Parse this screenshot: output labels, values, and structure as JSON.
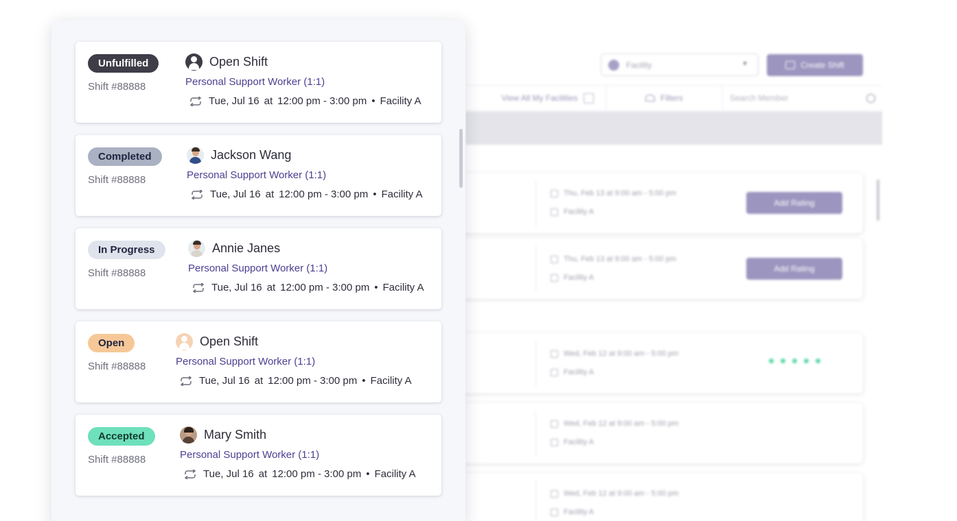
{
  "background": {
    "facility_select": {
      "placeholder": "Facility"
    },
    "create_button": {
      "label": "Create Shift"
    },
    "toolbar": {
      "view_all_label": "View All My Facilities",
      "filters_label": "Filters",
      "search_placeholder": "Search Member"
    },
    "rows": [
      {
        "date": "Thu, Feb 13  at  9:00 am - 5:00 pm",
        "facility": "Facility A",
        "action": "Add Rating"
      },
      {
        "date": "Thu, Feb 13  at  9:00 am - 5:00 pm",
        "facility": "Facility A",
        "action": "Add Rating"
      },
      {
        "date": "Wed, Feb 12  at  9:00 am - 5:00 pm",
        "facility": "Facility A",
        "rating": 5
      },
      {
        "date": "Wed, Feb 12  at  9:00 am - 5:00 pm",
        "facility": "Facility A"
      },
      {
        "date": "Wed, Feb 12  at  9:00 am - 5:00 pm",
        "facility": "Facility A"
      }
    ]
  },
  "cards": [
    {
      "status": "Unfulfilled",
      "status_bg": "#3e3d48",
      "status_fg": "#ffffff",
      "shift": "Shift #88888",
      "name": "Open Shift",
      "avatar": "generic-user-icon",
      "role": "Personal Support Worker (1:1)",
      "day": "Tue, Jul 16",
      "at": "at",
      "time": "12:00 pm - 3:00 pm",
      "sep": "•",
      "facility": "Facility A"
    },
    {
      "status": "Completed",
      "status_bg": "#a9b1c2",
      "status_fg": "#1f2340",
      "shift": "Shift #88888",
      "name": "Jackson Wang",
      "avatar": "jackson-wang-avatar",
      "role": "Personal Support Worker (1:1)",
      "day": "Tue, Jul 16",
      "at": "at",
      "time": "12:00 pm - 3:00 pm",
      "sep": "•",
      "facility": "Facility A"
    },
    {
      "status": "In Progress",
      "status_bg": "#dfe3ec",
      "status_fg": "#1f2340",
      "shift": "Shift #88888",
      "name": "Annie Janes",
      "avatar": "annie-janes-avatar",
      "role": "Personal Support Worker (1:1)",
      "day": "Tue, Jul 16",
      "at": "at",
      "time": "12:00 pm - 3:00 pm",
      "sep": "•",
      "facility": "Facility A"
    },
    {
      "status": "Open",
      "status_bg": "#f6c898",
      "status_fg": "#1f2340",
      "shift": "Shift #88888",
      "name": "Open Shift",
      "avatar": "open-user-icon",
      "role": "Personal Support Worker (1:1)",
      "day": "Tue, Jul 16",
      "at": "at",
      "time": "12:00 pm - 3:00 pm",
      "sep": "•",
      "facility": "Facility A"
    },
    {
      "status": "Accepted",
      "status_bg": "#6ee0bb",
      "status_fg": "#123a30",
      "shift": "Shift #88888",
      "name": "Mary Smith",
      "avatar": "mary-smith-avatar",
      "role": "Personal Support Worker (1:1)",
      "day": "Tue, Jul 16",
      "at": "at",
      "time": "12:00 pm - 3:00 pm",
      "sep": "•",
      "facility": "Facility A"
    }
  ]
}
